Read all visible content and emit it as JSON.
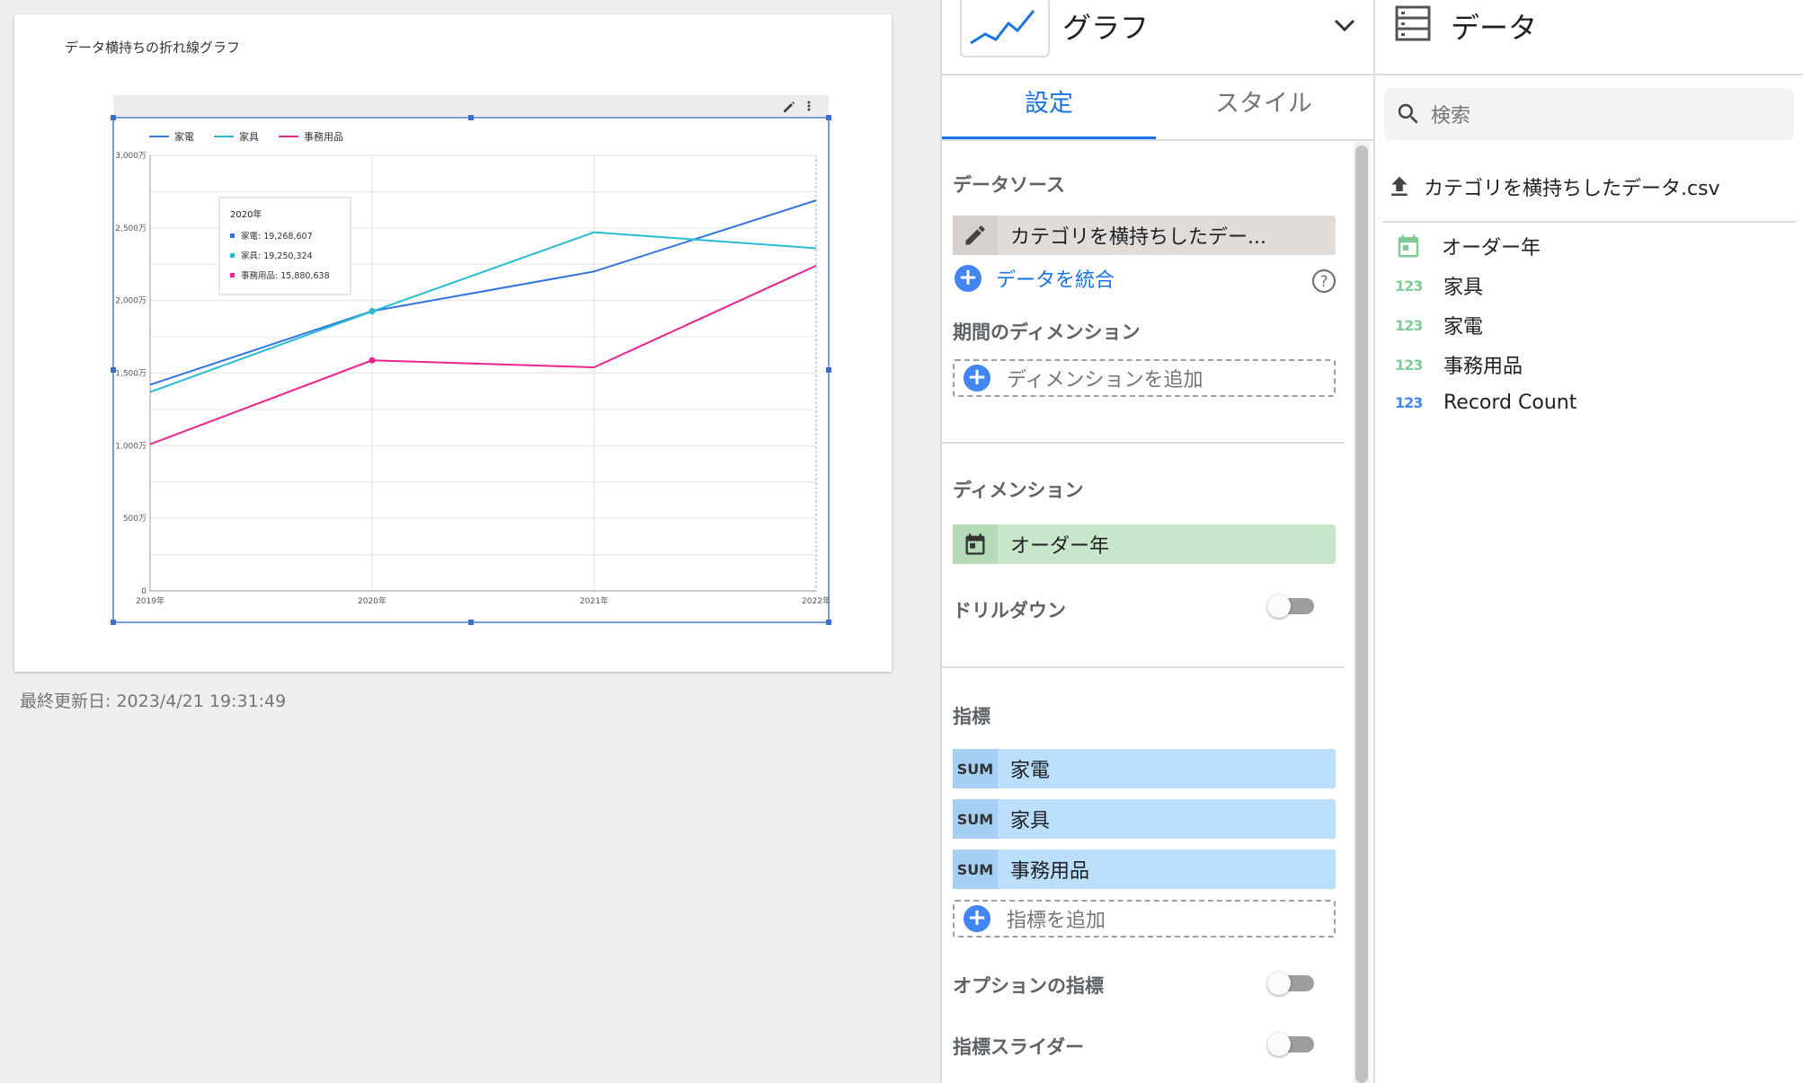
{
  "report": {
    "title": "データ横持ちの折れ線グラフ",
    "last_updated": "最終更新日: 2023/4/21 19:31:49"
  },
  "chart_data": {
    "type": "line",
    "categories": [
      "2019年",
      "2020年",
      "2021年",
      "2022年"
    ],
    "series": [
      {
        "name": "家電",
        "color": "#3275e0",
        "values": [
          14200000,
          19268607,
          22000000,
          26900000
        ]
      },
      {
        "name": "家具",
        "color": "#27bcd4",
        "values": [
          13700000,
          19250324,
          24700000,
          23600000
        ]
      },
      {
        "name": "事務用品",
        "color": "#ea248a",
        "values": [
          10100000,
          15880638,
          15400000,
          22400000
        ]
      }
    ],
    "y_ticks": [
      {
        "value": 0,
        "label": "0"
      },
      {
        "value": 5000000,
        "label": "500万"
      },
      {
        "value": 10000000,
        "label": "1,000万"
      },
      {
        "value": 15000000,
        "label": "1,500万"
      },
      {
        "value": 20000000,
        "label": "2,000万"
      },
      {
        "value": 25000000,
        "label": "2,500万"
      },
      {
        "value": 30000000,
        "label": "3,000万"
      }
    ],
    "ylim": [
      0,
      30000000
    ],
    "grid": true,
    "legend": "top-left",
    "tooltip": {
      "title": "2020年",
      "rows": [
        {
          "label": "家電: 19,268,607",
          "color": "#3275e0"
        },
        {
          "label": "家具: 19,250,324",
          "color": "#27bcd4"
        },
        {
          "label": "事務用品: 15,880,638",
          "color": "#ea248a"
        }
      ]
    }
  },
  "props": {
    "chart_type_label": "グラフ",
    "tabs": [
      "設定",
      "スタイル"
    ],
    "datasource": {
      "title": "データソース",
      "value": "カテゴリを横持ちしたデー...",
      "blend_label": "データを統合"
    },
    "date_dimension": {
      "title": "期間のディメンション",
      "add_label": "ディメンションを追加"
    },
    "dimension": {
      "title": "ディメンション",
      "value": "オーダー年"
    },
    "drilldown_label": "ドリルダウン",
    "metrics": {
      "title": "指標",
      "items": [
        {
          "agg": "SUM",
          "name": "家電"
        },
        {
          "agg": "SUM",
          "name": "家具"
        },
        {
          "agg": "SUM",
          "name": "事務用品"
        }
      ],
      "add_label": "指標を追加"
    },
    "optional_metrics_label": "オプションの指標",
    "metric_slider_label": "指標スライダー"
  },
  "data_panel": {
    "title": "データ",
    "search_placeholder": "検索",
    "file_name": "カテゴリを横持ちしたデータ.csv",
    "fields": [
      {
        "type": "date",
        "name": "オーダー年",
        "color": "#81c995"
      },
      {
        "type": "123",
        "name": "家具",
        "color": "#81c995"
      },
      {
        "type": "123",
        "name": "家電",
        "color": "#81c995"
      },
      {
        "type": "123",
        "name": "事務用品",
        "color": "#81c995"
      },
      {
        "type": "123",
        "name": "Record Count",
        "color": "#4285f4"
      }
    ]
  },
  "colors": {
    "accent": "#1a73e8",
    "dimension_chip": "#c8e6c9",
    "metric_chip": "#bbdefb",
    "datasource_chip": "#e0dcd9"
  }
}
